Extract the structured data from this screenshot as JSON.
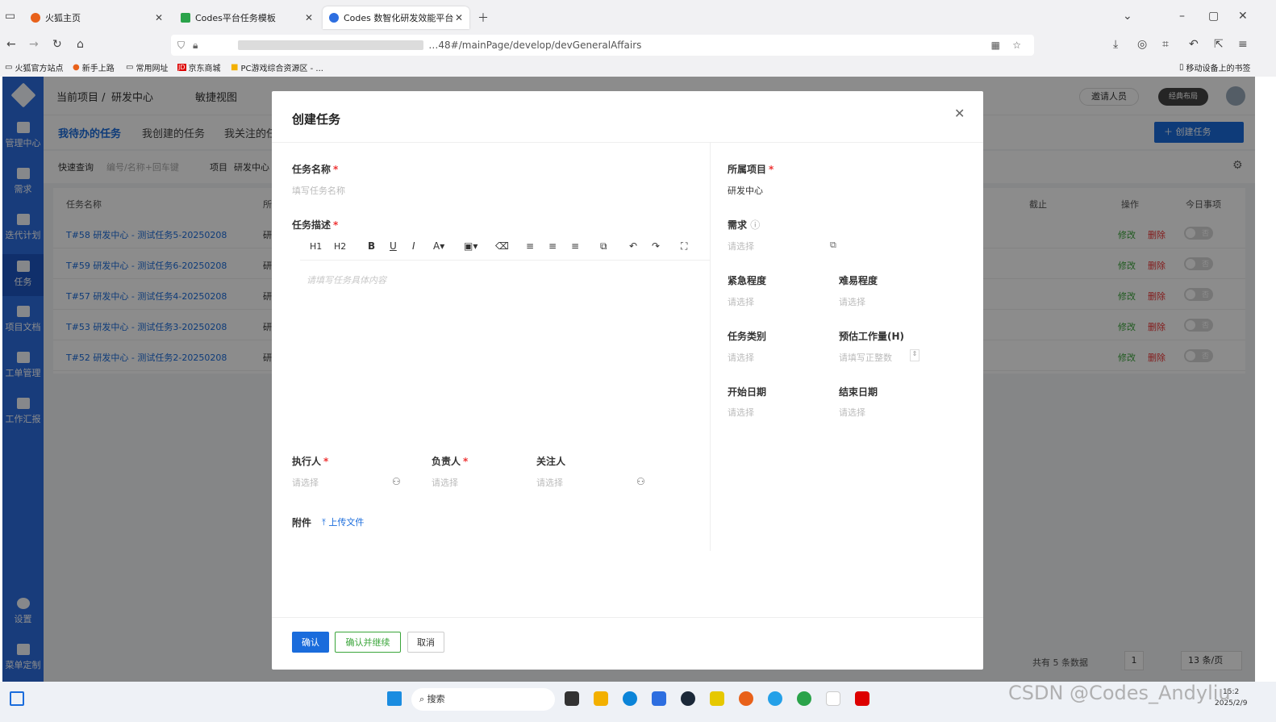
{
  "browser": {
    "tabs": [
      {
        "label": "火狐主页"
      },
      {
        "label": "Codes平台任务模板"
      },
      {
        "label": "Codes 数智化研发效能平台"
      }
    ],
    "url": "…48#/mainPage/develop/devGeneralAffairs",
    "bookmarks": [
      "火狐官方站点",
      "新手上路",
      "常用网址",
      "京东商城",
      "PC游戏综合资源区 - ..."
    ],
    "mobile_bookmarks": "移动设备上的书签"
  },
  "sidebar": {
    "items": [
      {
        "label": "管理中心"
      },
      {
        "label": "需求"
      },
      {
        "label": "迭代计划"
      },
      {
        "label": "任务"
      },
      {
        "label": "项目文档"
      },
      {
        "label": "工单管理"
      },
      {
        "label": "工作汇报"
      },
      {
        "label": "设置"
      },
      {
        "label": "菜单定制"
      }
    ]
  },
  "header": {
    "project_prefix": "当前项目 /",
    "project": "研发中心",
    "view": "敏捷视图",
    "invite": "邀请人员",
    "layout_toggle": "经典布局",
    "create_button": "创建任务"
  },
  "tabs": [
    "我待办的任务",
    "我创建的任务",
    "我关注的任"
  ],
  "filter": {
    "quick_label": "快速查询",
    "quick_placeholder": "编号/名称+回车键",
    "project_label": "项目",
    "project_value": "研发中心"
  },
  "table": {
    "headers": [
      "任务名称",
      "所",
      "截止",
      "操作",
      "今日事项"
    ],
    "rows": [
      {
        "name": "T#58 研发中心 - 测试任务5-20250208",
        "col2": "研"
      },
      {
        "name": "T#59 研发中心 - 测试任务6-20250208",
        "col2": "研"
      },
      {
        "name": "T#57 研发中心 - 测试任务4-20250208",
        "col2": "研"
      },
      {
        "name": "T#53 研发中心 - 测试任务3-20250208",
        "col2": "研"
      },
      {
        "name": "T#52 研发中心 - 测试任务2-20250208",
        "col2": "研"
      }
    ],
    "edit_label": "修改",
    "delete_label": "删除",
    "toggle_label": "否"
  },
  "pagination": {
    "total": "共有 5 条数据",
    "page": "1",
    "page_size": "13 条/页"
  },
  "modal": {
    "title": "创建任务",
    "task_name_label": "任务名称",
    "task_name_placeholder": "填写任务名称",
    "task_desc_label": "任务描述",
    "editor_placeholder": "请填写任务具体内容",
    "toolbar": [
      "H1",
      "H2",
      "B",
      "U",
      "I",
      "A▾",
      "▣▾",
      "⌫",
      "≡",
      "≡",
      "≡",
      "⧉",
      "↶",
      "↷",
      "⛶"
    ],
    "executor_label": "执行人",
    "owner_label": "负责人",
    "watcher_label": "关注人",
    "select_placeholder": "请选择",
    "attachment_label": "附件",
    "upload_label": "上传文件",
    "project_label": "所属项目",
    "project_value": "研发中心",
    "demand_label": "需求",
    "urgency_label": "紧急程度",
    "difficulty_label": "难易程度",
    "category_label": "任务类别",
    "estimate_label": "预估工作量(H)",
    "estimate_placeholder": "请填写正整数",
    "start_label": "开始日期",
    "end_label": "结束日期",
    "confirm": "确认",
    "confirm_continue": "确认并继续",
    "cancel": "取消"
  },
  "taskbar": {
    "search": "搜索",
    "date": "2025/2/9",
    "time": "15:2"
  },
  "watermark": "CSDN @Codes_Andyliu"
}
